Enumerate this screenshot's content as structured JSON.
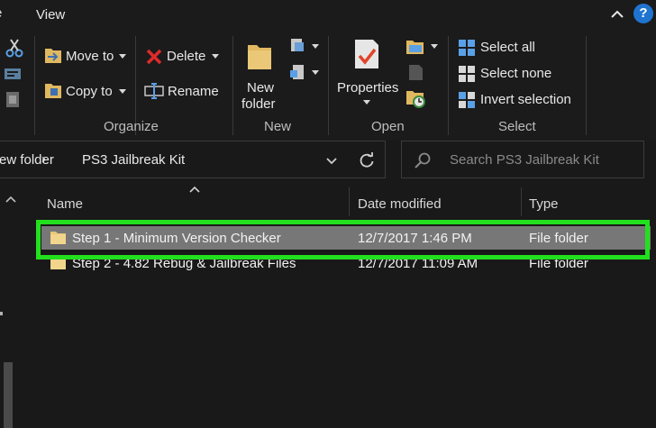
{
  "menubar": {
    "left_tab": "e",
    "view_tab": "View",
    "help_glyph": "?"
  },
  "ribbon": {
    "organize": {
      "move_to": "Move to",
      "copy_to": "Copy to",
      "delete": "Delete",
      "rename": "Rename",
      "label": "Organize"
    },
    "new": {
      "new_folder_line1": "New",
      "new_folder_line2": "folder",
      "label": "New"
    },
    "open": {
      "properties": "Properties",
      "label": "Open"
    },
    "select": {
      "select_all": "Select all",
      "select_none": "Select none",
      "invert_selection": "Invert selection",
      "label": "Select"
    }
  },
  "address": {
    "crumb_partial": "ew folder",
    "crumb_separator": "›",
    "current": "PS3 Jailbreak Kit"
  },
  "search": {
    "placeholder": "Search PS3 Jailbreak Kit"
  },
  "columns": {
    "name": "Name",
    "date_modified": "Date modified",
    "type": "Type"
  },
  "files": [
    {
      "name": "Step 1 - Minimum Version Checker",
      "date": "12/7/2017 1:46 PM",
      "type": "File folder",
      "selected": true
    },
    {
      "name": "Step 2 - 4.82 Rebug & Jailbreak Files",
      "date": "12/7/2017 11:09 AM",
      "type": "File folder",
      "selected": false
    }
  ],
  "colors": {
    "background": "#191919",
    "selection": "#777777",
    "highlight_outline": "#22e01e",
    "help_blue": "#1f74d0",
    "delete_red": "#e02a2a"
  },
  "icons": [
    "cut-icon",
    "move-to-icon",
    "copy-to-icon",
    "delete-icon",
    "rename-icon",
    "new-folder-icon",
    "new-item-icon",
    "easy-access-icon",
    "properties-icon",
    "open-icon",
    "edit-icon",
    "history-icon",
    "select-all-icon",
    "select-none-icon",
    "invert-selection-icon",
    "search-icon",
    "refresh-icon",
    "folder-icon"
  ]
}
